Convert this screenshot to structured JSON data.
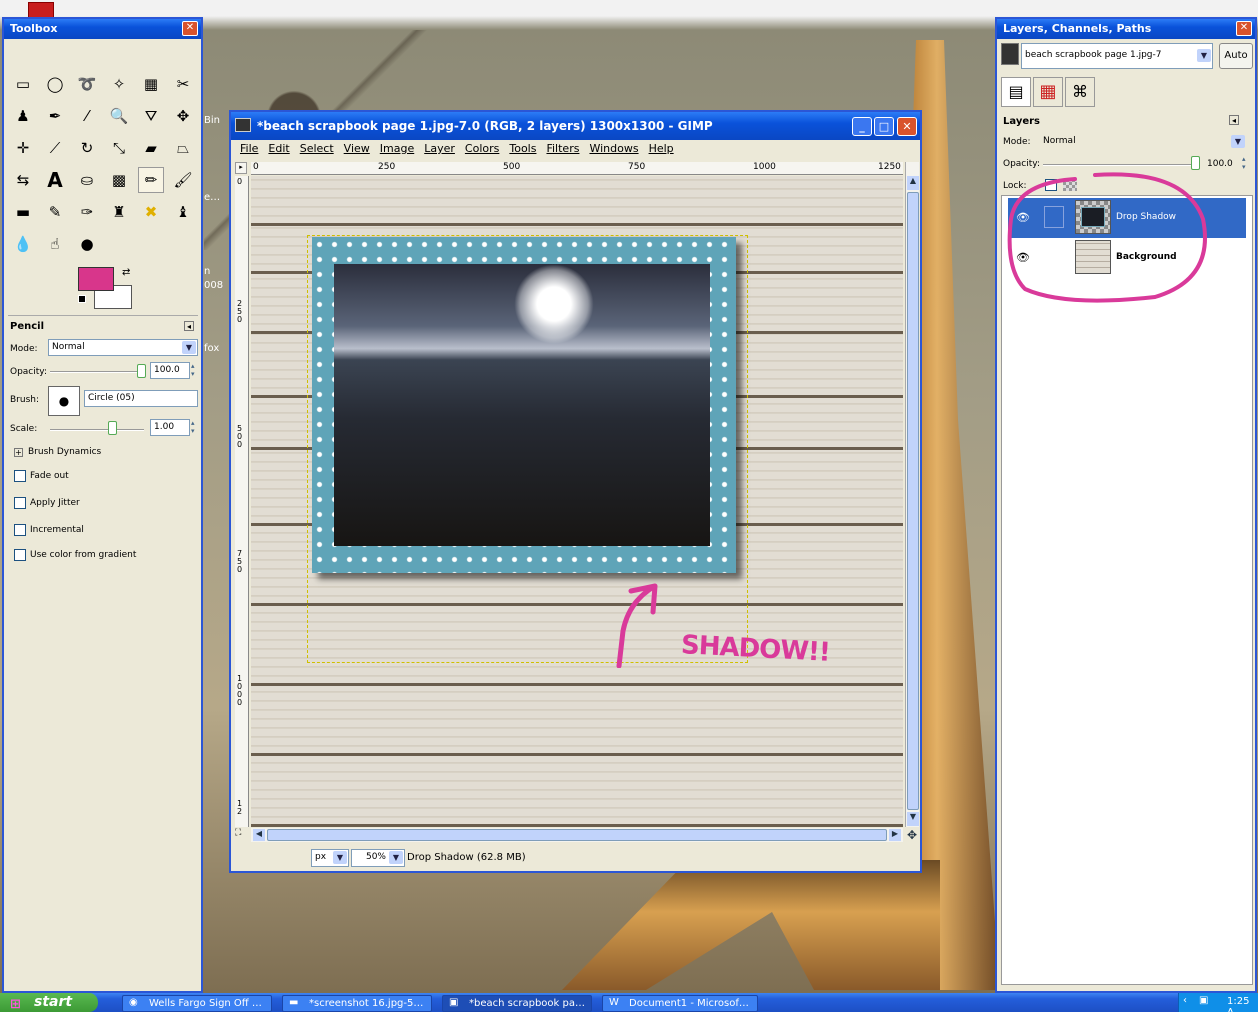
{
  "desktop": {
    "side_texts": [
      "Bin",
      "e…",
      "n",
      "008",
      "fox"
    ]
  },
  "toolbox": {
    "title": "Toolbox",
    "tool_options_title": "Pencil",
    "mode_label": "Mode:",
    "mode_value": "Normal",
    "opacity_label": "Opacity:",
    "opacity_value": "100.0",
    "brush_label": "Brush:",
    "brush_value": "Circle (05)",
    "scale_label": "Scale:",
    "scale_value": "1.00",
    "brush_dynamics": "Brush Dynamics",
    "checkboxes": [
      "Fade out",
      "Apply Jitter",
      "Incremental",
      "Use color from gradient"
    ],
    "colors": {
      "fg": "#d8368b",
      "bg": "#ffffff"
    }
  },
  "gimp": {
    "title": "*beach scrapbook page 1.jpg-7.0 (RGB, 2 layers) 1300x1300 - GIMP",
    "menu": [
      "File",
      "Edit",
      "Select",
      "View",
      "Image",
      "Layer",
      "Colors",
      "Tools",
      "Filters",
      "Windows",
      "Help"
    ],
    "ruler_top": [
      "0",
      "250",
      "500",
      "750",
      "1000",
      "1250"
    ],
    "ruler_left": [
      "0",
      "250",
      "500",
      "750",
      "1000",
      "12"
    ],
    "unit": "px",
    "zoom": "50%",
    "status": "Drop Shadow (62.8 MB)",
    "annotation": "SHADOW!!"
  },
  "layers_dialog": {
    "title": "Layers, Channels, Paths",
    "image_select": "beach scrapbook page 1.jpg-7",
    "auto_button": "Auto",
    "section": "Layers",
    "mode_label": "Mode:",
    "mode_value": "Normal",
    "opacity_label": "Opacity:",
    "opacity_value": "100.0",
    "lock_label": "Lock:",
    "layers": [
      {
        "name": "Drop Shadow",
        "selected": true
      },
      {
        "name": "Background",
        "selected": false
      }
    ]
  },
  "taskbar": {
    "start": "start",
    "tasks": [
      "Wells Fargo Sign Off …",
      "*screenshot 16.jpg-5…",
      "*beach scrapbook pa…",
      "Document1 - Microsof…"
    ],
    "clock": "1:25 A"
  }
}
